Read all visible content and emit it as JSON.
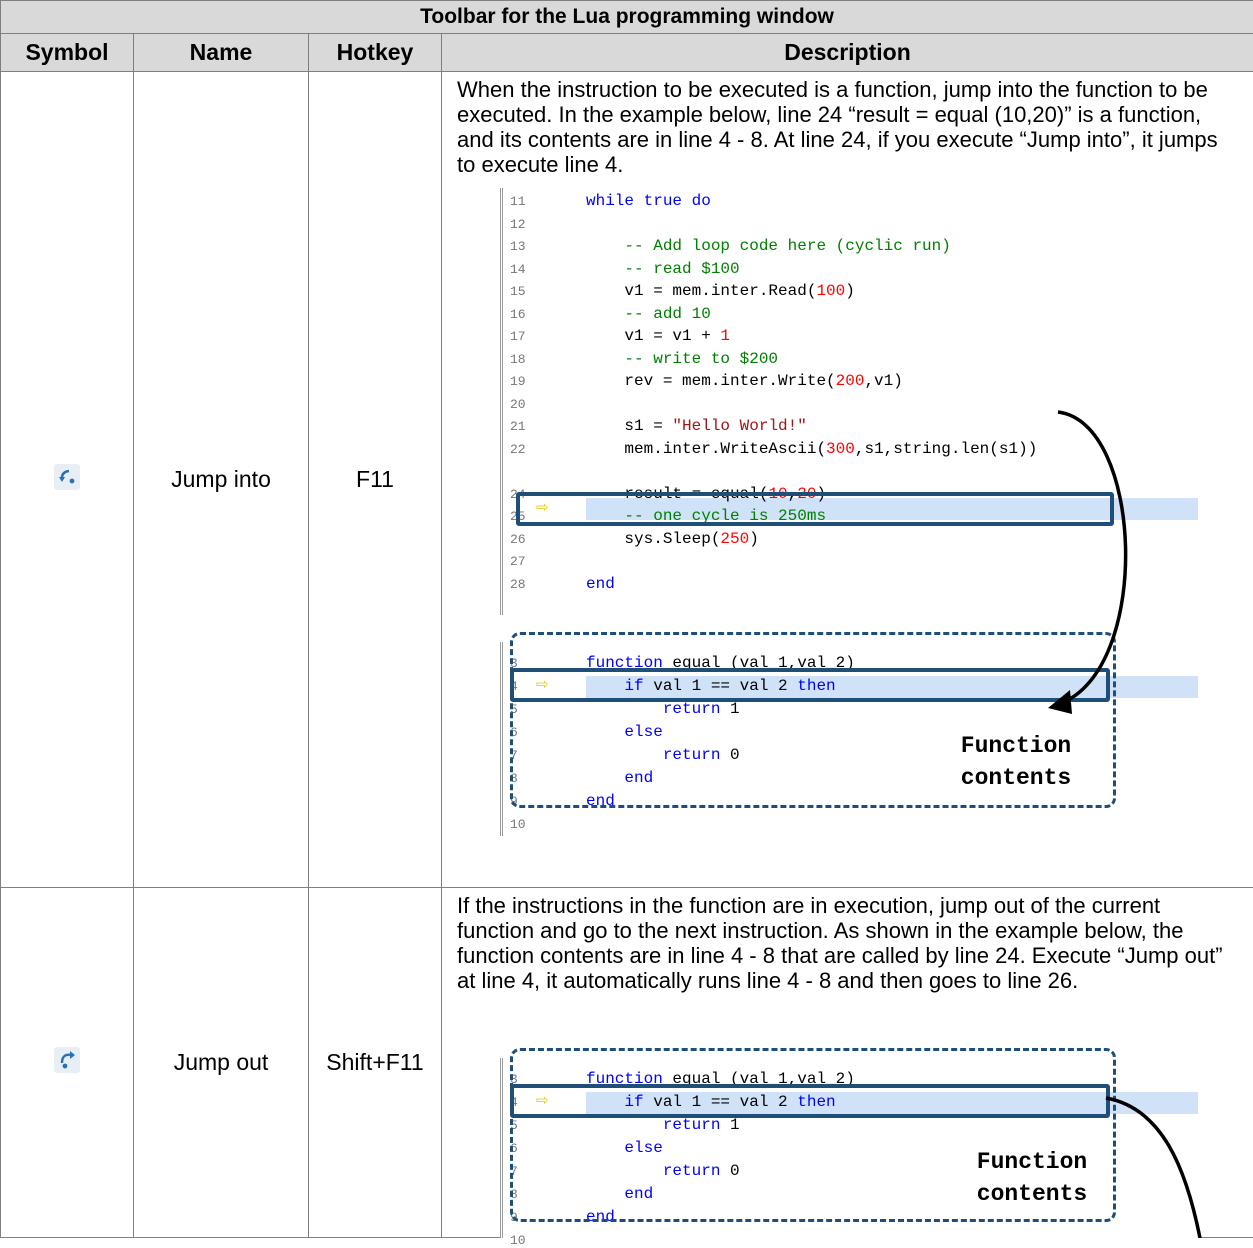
{
  "table": {
    "title": "Toolbar for the Lua programming window",
    "headers": [
      "Symbol",
      "Name",
      "Hotkey",
      "Description"
    ]
  },
  "rows": [
    {
      "symbol_icon": "step-into-icon",
      "name": "Jump into",
      "hotkey": "F11",
      "description": "When the instruction to be executed is a function, jump into the function to be executed. In the example below, line 24 “result = equal (10,20)” is a function, and its contents are in line 4 - 8. At line 24, if you execute “Jump into”, it jumps to execute line 4."
    },
    {
      "symbol_icon": "step-out-icon",
      "name": "Jump out",
      "hotkey": "Shift+F11",
      "description": "If the instructions in the function are in execution, jump out of the current function and go to the next instruction. As shown in the example below, the function contents are in line 4 - 8 that are called by line 24. Execute “Jump out” at line 4, it automatically runs line 4 - 8 and then goes to line 26."
    }
  ],
  "annotation": {
    "function_contents_line1": "Function",
    "function_contents_line2": "contents"
  },
  "code_main": [
    {
      "n": "11",
      "t": "while true do"
    },
    {
      "n": "12",
      "t": ""
    },
    {
      "n": "13",
      "t": "    -- Add loop code here (cyclic run)"
    },
    {
      "n": "14",
      "t": "    -- read $100"
    },
    {
      "n": "15",
      "t": "    v1 = mem.inter.Read(100)"
    },
    {
      "n": "16",
      "t": "    -- add 10"
    },
    {
      "n": "17",
      "t": "    v1 = v1 + 1"
    },
    {
      "n": "18",
      "t": "    -- write to $200"
    },
    {
      "n": "19",
      "t": "    rev = mem.inter.Write(200,v1)"
    },
    {
      "n": "20",
      "t": ""
    },
    {
      "n": "21",
      "t": "    s1 = \"Hello World!\""
    },
    {
      "n": "22",
      "t": "    mem.inter.WriteAscii(300,s1,string.len(s1))"
    },
    {
      "n": "24",
      "t": "    result = equal(10,20)"
    },
    {
      "n": "25",
      "t": "    -- one cycle is 250ms"
    },
    {
      "n": "26",
      "t": "    sys.Sleep(250)"
    },
    {
      "n": "27",
      "t": ""
    },
    {
      "n": "28",
      "t": "end"
    }
  ],
  "code_func": [
    {
      "n": "3",
      "t": "function equal (val_1,val_2)"
    },
    {
      "n": "4",
      "t": "    if val 1 == val 2 then"
    },
    {
      "n": "5",
      "t": "        return 1"
    },
    {
      "n": "6",
      "t": "    else"
    },
    {
      "n": "7",
      "t": "        return 0"
    },
    {
      "n": "8",
      "t": "    end"
    },
    {
      "n": "9",
      "t": "end"
    },
    {
      "n": "10",
      "t": ""
    }
  ]
}
